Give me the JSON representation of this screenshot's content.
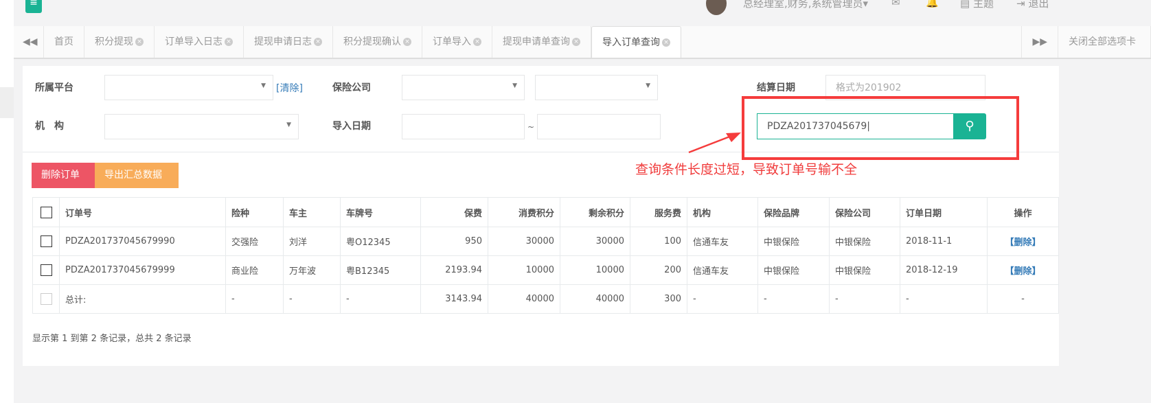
{
  "header": {
    "user": "总经理室,财务,系统管理员",
    "theme": "主题",
    "logout": "退出"
  },
  "tabs": [
    "首页",
    "积分提现",
    "订单导入日志",
    "提现申请日志",
    "积分提现确认",
    "订单导入",
    "提现申请单查询",
    "导入订单查询"
  ],
  "close_all": "关闭全部选项卡",
  "filters": {
    "platform": "所属平台",
    "clear": "[清除]",
    "insurer": "保险公司",
    "settle_date": "结算日期",
    "settle_placeholder": "格式为201902",
    "org": "机　构",
    "import_date": "导入日期",
    "tilde": "~",
    "search_value": "PDZA201737045679"
  },
  "annotation": "查询条件长度过短，导致订单号输不全",
  "buttons": {
    "delete": "删除订单",
    "export": "导出汇总数据"
  },
  "table": {
    "headers": [
      "订单号",
      "险种",
      "车主",
      "车牌号",
      "保费",
      "消费积分",
      "剩余积分",
      "服务费",
      "机构",
      "保险品牌",
      "保险公司",
      "订单日期",
      "操作"
    ],
    "rows": [
      [
        "PDZA201737045679990",
        "交强险",
        "刘洋",
        "粤O12345",
        "950",
        "30000",
        "30000",
        "100",
        "信通车友",
        "中银保险",
        "中银保险",
        "2018-11-1",
        "【删除】"
      ],
      [
        "PDZA201737045679999",
        "商业险",
        "万年波",
        "粤B12345",
        "2193.94",
        "10000",
        "10000",
        "200",
        "信通车友",
        "中银保险",
        "中银保险",
        "2018-12-19",
        "【删除】"
      ],
      [
        "总计:",
        "-",
        "-",
        "-",
        "3143.94",
        "40000",
        "40000",
        "300",
        "-",
        "-",
        "-",
        "-",
        "-"
      ]
    ]
  },
  "footer": "显示第 1 到第 2 条记录，总共 2 条记录",
  "colors": {
    "accent": "#1ab394",
    "danger": "#ed5565",
    "warning": "#f8ac59",
    "annotation": "#f53c3c"
  }
}
